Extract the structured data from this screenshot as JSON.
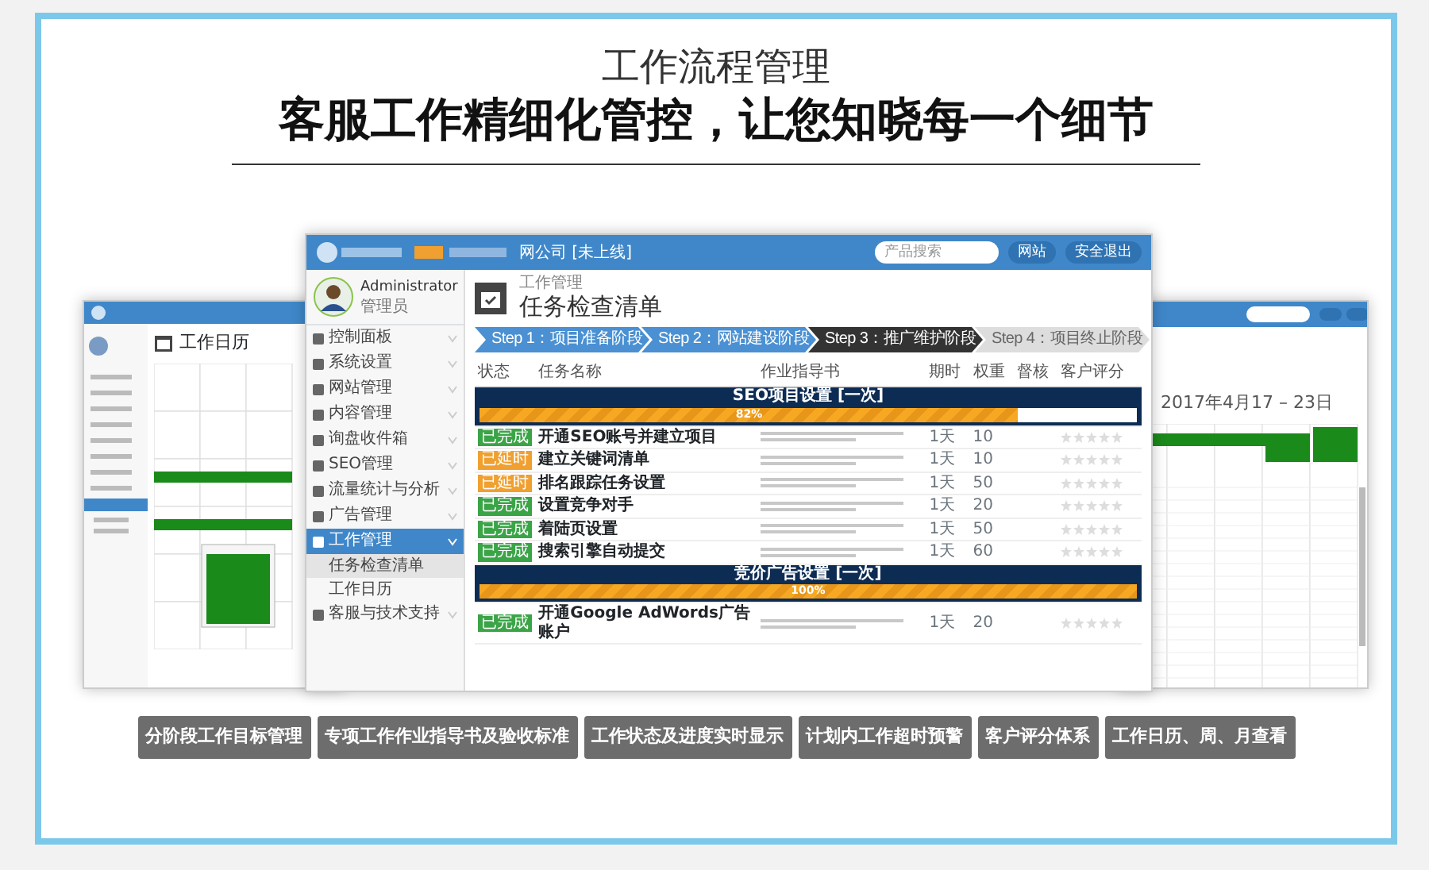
{
  "header": {
    "title": "工作流程管理",
    "subtitle": "客服工作精细化管控，让您知晓每一个细节"
  },
  "left_window": {
    "page_title": "工作日历"
  },
  "right_window": {
    "date_range": "2017年4月17 – 23日"
  },
  "main_window": {
    "topbar": {
      "company": "网公司 [未上线]",
      "search": {
        "placeholder": "产品搜索"
      },
      "site_menu": "网站",
      "logout": "安全退出"
    },
    "user": {
      "name": "Administrator",
      "role": "管理员"
    },
    "sidebar": {
      "items": [
        {
          "label": "控制面板",
          "selected": false,
          "expanded": false
        },
        {
          "label": "系统设置",
          "selected": false,
          "expanded": false
        },
        {
          "label": "网站管理",
          "selected": false,
          "expanded": false
        },
        {
          "label": "内容管理",
          "selected": false,
          "expanded": false
        },
        {
          "label": "询盘收件箱",
          "selected": false,
          "expanded": false
        },
        {
          "label": "SEO管理",
          "selected": false,
          "expanded": false
        },
        {
          "label": "流量统计与分析",
          "selected": false,
          "expanded": false
        },
        {
          "label": "广告管理",
          "selected": false,
          "expanded": false
        },
        {
          "label": "工作管理",
          "selected": true,
          "expanded": true,
          "children": [
            {
              "label": "任务检查清单",
              "selected": true
            },
            {
              "label": "工作日历",
              "selected": false
            }
          ]
        },
        {
          "label": "客服与技术支持",
          "selected": false,
          "expanded": false
        }
      ]
    },
    "breadcrumb": "工作管理",
    "page_title": "任务检查清单",
    "steps": [
      {
        "label": "Step 1：项目准备阶段",
        "kind": "done"
      },
      {
        "label": "Step 2：网站建设阶段",
        "kind": "done"
      },
      {
        "label": "Step 3：推广维护阶段",
        "kind": "current"
      },
      {
        "label": "Step 4：项目终止阶段",
        "kind": "todo"
      }
    ],
    "table": {
      "columns": [
        "状态",
        "任务名称",
        "作业指导书",
        "期时",
        "权重",
        "督核",
        "客户评分"
      ],
      "groups": [
        {
          "title": "SEO项目设置 [一次]",
          "level": 0.82,
          "reading": "82%",
          "rows": [
            {
              "status": "已完成",
              "color": "#3aa447",
              "name": "开通SEO账号并建立项目",
              "period": "1天",
              "weight": "10",
              "stars": 0
            },
            {
              "status": "已延时",
              "color": "#f0a030",
              "name": "建立关键词清单",
              "period": "1天",
              "weight": "10",
              "stars": 0
            },
            {
              "status": "已延时",
              "color": "#f0a030",
              "name": "排名跟踪任务设置",
              "period": "1天",
              "weight": "50",
              "stars": 0
            },
            {
              "status": "已完成",
              "color": "#3aa447",
              "name": "设置竞争对手",
              "period": "1天",
              "weight": "20",
              "stars": 0
            },
            {
              "status": "已完成",
              "color": "#3aa447",
              "name": "着陆页设置",
              "period": "1天",
              "weight": "50",
              "stars": 0
            },
            {
              "status": "已完成",
              "color": "#3aa447",
              "name": "搜索引擎自动提交",
              "period": "1天",
              "weight": "60",
              "stars": 0
            }
          ]
        },
        {
          "title": "竞价广告设置 [一次]",
          "level": 1,
          "reading": "100%",
          "rows": [
            {
              "status": "已完成",
              "color": "#3aa447",
              "name": "开通Google AdWords广告账户",
              "period": "1天",
              "weight": "20",
              "stars": 0
            }
          ]
        }
      ]
    }
  },
  "features": [
    "分阶段工作目标管理",
    "专项工作作业指导书及验收标准",
    "工作状态及进度实时显示",
    "计划内工作超时预警",
    "客户评分体系",
    "工作日历、周、月查看"
  ]
}
